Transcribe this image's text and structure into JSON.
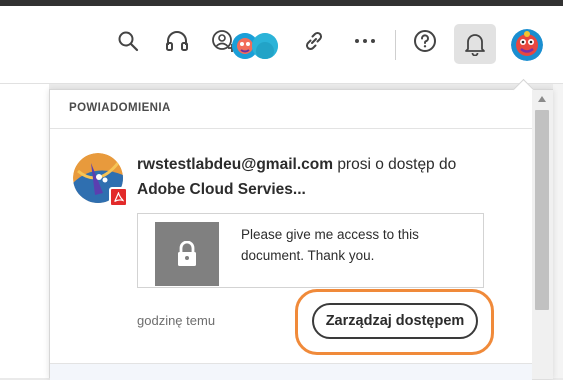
{
  "toolbar": {
    "icons": [
      "search-icon",
      "headphones-icon",
      "add-collaborator-icon",
      "link-icon",
      "more-icon",
      "help-icon",
      "bell-icon"
    ],
    "bell_active_bg": "#e2e2e2"
  },
  "panel": {
    "title": "POWIADOMIENIA"
  },
  "notification": {
    "email": "rwstestlabdeu@gmail.com",
    "action_text": "prosi o dostęp do",
    "document_name": "Adobe Cloud Servies...",
    "message": "Please give me access to this document. Thank you.",
    "time_ago": "godzinę temu",
    "manage_button": "Zarządzaj dostępem"
  },
  "colors": {
    "highlight_outline": "#f08a3a",
    "pdf_badge": "#e22a2a"
  }
}
